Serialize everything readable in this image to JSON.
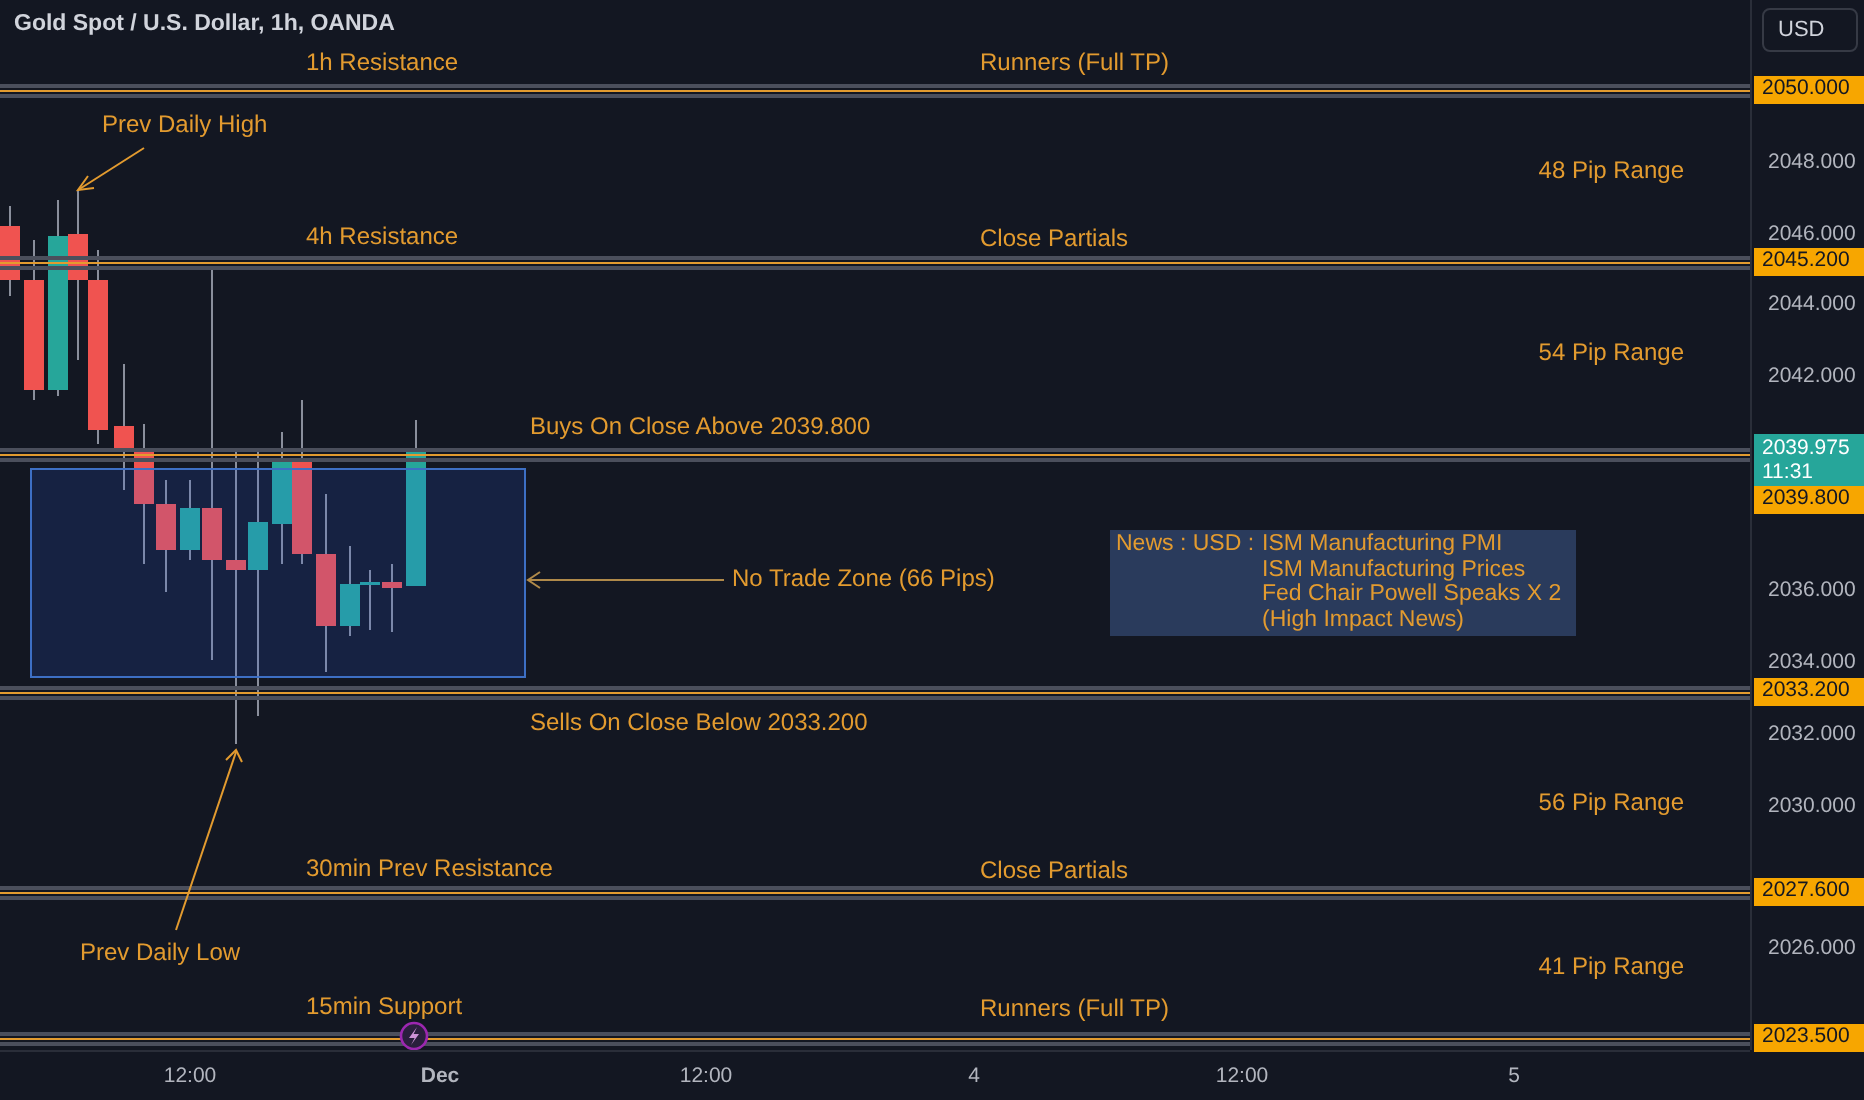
{
  "chart_header": {
    "title": "Gold Spot / U.S. Dollar, 1h, OANDA",
    "currency": "USD"
  },
  "levels": [
    {
      "price": "2050.000",
      "labels": [
        "1h Resistance",
        "Runners (Full TP)"
      ]
    },
    {
      "price": "2045.200",
      "labels": [
        "4h Resistance",
        "Close Partials"
      ]
    },
    {
      "price": "2039.800",
      "labels": [
        "Buys On Close Above 2039.800"
      ]
    },
    {
      "price": "2033.200",
      "labels": [
        "Sells On Close Below 2033.200"
      ]
    },
    {
      "price": "2027.600",
      "labels": [
        "30min Prev Resistance",
        "Close Partials"
      ]
    },
    {
      "price": "2023.500",
      "labels": [
        "15min Support",
        "Runners (Full TP)"
      ]
    }
  ],
  "ranges": [
    "48 Pip Range",
    "54 Pip Range",
    "56 Pip Range",
    "41 Pip Range"
  ],
  "price_ticks": [
    "2048.000",
    "2046.000",
    "2044.000",
    "2042.000",
    "2036.000",
    "2034.000",
    "2032.000",
    "2030.000",
    "2026.000"
  ],
  "current_price": {
    "price": "2039.975",
    "countdown": "11:31"
  },
  "annotations": {
    "prev_daily_high": "Prev Daily High",
    "prev_daily_low": "Prev Daily Low",
    "no_trade_zone": "No Trade Zone (66 Pips)"
  },
  "news": {
    "prefix": "News : USD :",
    "items": [
      "ISM Manufacturing PMI",
      "ISM Manufacturing Prices",
      "Fed Chair Powell Speaks X 2",
      "(High Impact News)"
    ]
  },
  "time_axis": [
    {
      "label": "12:00",
      "bold": false
    },
    {
      "label": "Dec",
      "bold": true
    },
    {
      "label": "12:00",
      "bold": false
    },
    {
      "label": "4",
      "bold": false
    },
    {
      "label": "12:00",
      "bold": false
    },
    {
      "label": "5",
      "bold": false
    }
  ]
}
